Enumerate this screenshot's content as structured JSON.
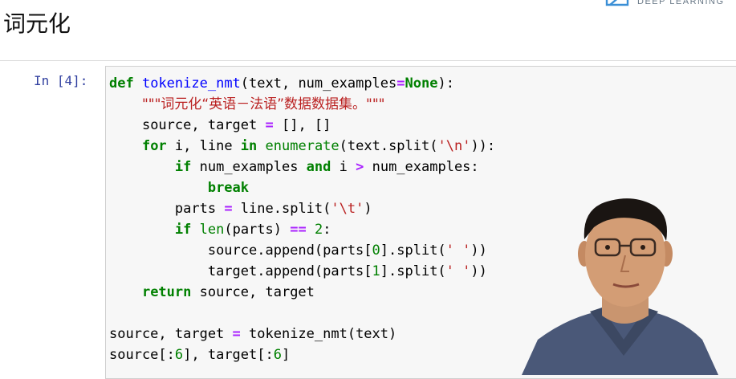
{
  "header": {
    "title": "词元化",
    "logo_text": "DEEP LEARNING"
  },
  "cell": {
    "prompt": "In [4]:",
    "lines": [
      {
        "indent": "",
        "tokens": [
          [
            "kw",
            "def"
          ],
          [
            "p",
            " "
          ],
          [
            "fn",
            "tokenize_nmt"
          ],
          [
            "p",
            "(text, num_examples"
          ],
          [
            "op",
            "="
          ],
          [
            "kw",
            "None"
          ],
          [
            "p",
            "):"
          ]
        ]
      },
      {
        "indent": "    ",
        "tokens": [
          [
            "st",
            "\"\"\"词元化“英语－法语”数据数据集。\"\"\""
          ]
        ]
      },
      {
        "indent": "    ",
        "tokens": [
          [
            "p",
            "source, target "
          ],
          [
            "op",
            "="
          ],
          [
            "p",
            " [], []"
          ]
        ]
      },
      {
        "indent": "    ",
        "tokens": [
          [
            "kw",
            "for"
          ],
          [
            "p",
            " i, line "
          ],
          [
            "kw",
            "in"
          ],
          [
            "p",
            " "
          ],
          [
            "bi",
            "enumerate"
          ],
          [
            "p",
            "(text.split("
          ],
          [
            "st",
            "'\\n'"
          ],
          [
            "p",
            ")):"
          ]
        ]
      },
      {
        "indent": "        ",
        "tokens": [
          [
            "kw",
            "if"
          ],
          [
            "p",
            " num_examples "
          ],
          [
            "kw",
            "and"
          ],
          [
            "p",
            " i "
          ],
          [
            "op",
            ">"
          ],
          [
            "p",
            " num_examples:"
          ]
        ]
      },
      {
        "indent": "            ",
        "tokens": [
          [
            "kw",
            "break"
          ]
        ]
      },
      {
        "indent": "        ",
        "tokens": [
          [
            "p",
            "parts "
          ],
          [
            "op",
            "="
          ],
          [
            "p",
            " line.split("
          ],
          [
            "st",
            "'\\t'"
          ],
          [
            "p",
            ")"
          ]
        ]
      },
      {
        "indent": "        ",
        "tokens": [
          [
            "kw",
            "if"
          ],
          [
            "p",
            " "
          ],
          [
            "bi",
            "len"
          ],
          [
            "p",
            "(parts) "
          ],
          [
            "op",
            "=="
          ],
          [
            "p",
            " "
          ],
          [
            "nm",
            "2"
          ],
          [
            "p",
            ":"
          ]
        ]
      },
      {
        "indent": "            ",
        "tokens": [
          [
            "p",
            "source.append(parts["
          ],
          [
            "nm",
            "0"
          ],
          [
            "p",
            "].split("
          ],
          [
            "st",
            "' '"
          ],
          [
            "p",
            "))"
          ]
        ]
      },
      {
        "indent": "            ",
        "tokens": [
          [
            "p",
            "target.append(parts["
          ],
          [
            "nm",
            "1"
          ],
          [
            "p",
            "].split("
          ],
          [
            "st",
            "' '"
          ],
          [
            "p",
            "))"
          ]
        ]
      },
      {
        "indent": "    ",
        "tokens": [
          [
            "kw",
            "return"
          ],
          [
            "p",
            " source, target"
          ]
        ]
      },
      {
        "indent": "",
        "tokens": []
      },
      {
        "indent": "",
        "tokens": [
          [
            "p",
            "source, target "
          ],
          [
            "op",
            "="
          ],
          [
            "p",
            " tokenize_nmt(text)"
          ]
        ]
      },
      {
        "indent": "",
        "tokens": [
          [
            "p",
            "source[:"
          ],
          [
            "nm",
            "6"
          ],
          [
            "p",
            "], target[:"
          ],
          [
            "nm",
            "6"
          ],
          [
            "p",
            "]"
          ]
        ]
      }
    ]
  },
  "presenter": {
    "icon": "presenter-video-icon"
  },
  "colors": {
    "keyword": "#008000",
    "function": "#0000ff",
    "operator": "#aa22ff",
    "string": "#ba2121",
    "prompt": "#303f9f",
    "cell_bg": "#f7f7f7"
  }
}
